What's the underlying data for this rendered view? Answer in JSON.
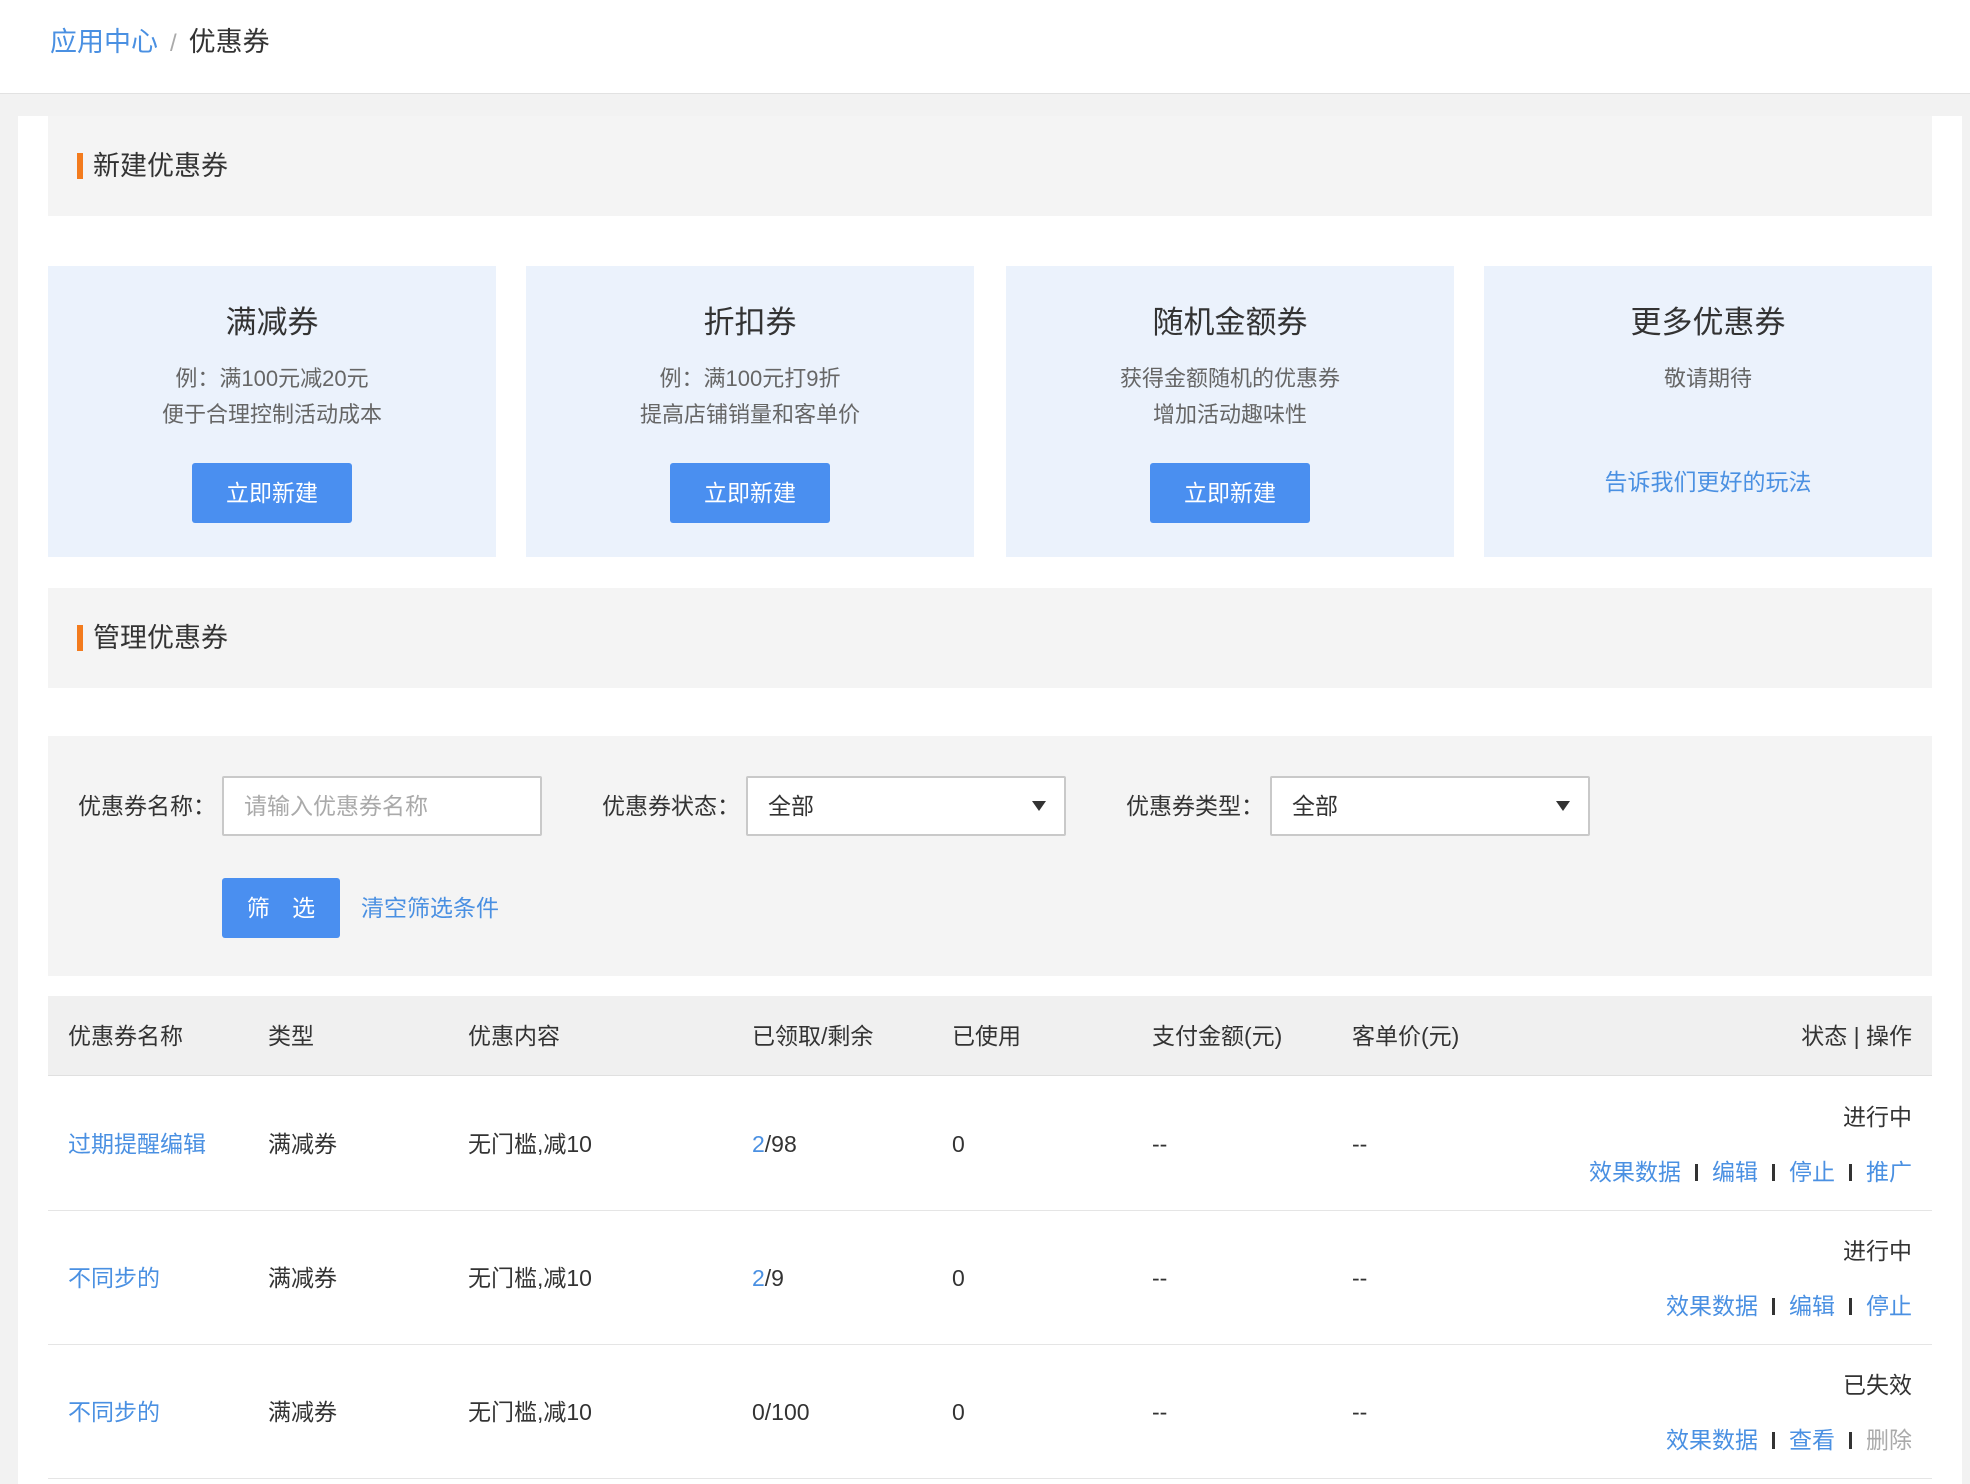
{
  "breadcrumb": {
    "parent": "应用中心",
    "separator": "/",
    "current": "优惠券"
  },
  "create_section": {
    "title": "新建优惠券"
  },
  "cards": [
    {
      "title": "满减券",
      "desc1": "例：满100元减20元",
      "desc2": "便于合理控制活动成本",
      "button": "立即新建"
    },
    {
      "title": "折扣券",
      "desc1": "例：满100元打9折",
      "desc2": "提高店铺销量和客单价",
      "button": "立即新建"
    },
    {
      "title": "随机金额券",
      "desc1": "获得金额随机的优惠券",
      "desc2": "增加活动趣味性",
      "button": "立即新建"
    },
    {
      "title": "更多优惠券",
      "desc1": "敬请期待",
      "link": "告诉我们更好的玩法"
    }
  ],
  "manage_section": {
    "title": "管理优惠券"
  },
  "filter": {
    "name_label": "优惠券名称：",
    "name_placeholder": "请输入优惠券名称",
    "status_label": "优惠券状态：",
    "status_value": "全部",
    "type_label": "优惠券类型：",
    "type_value": "全部",
    "submit": "筛 选",
    "clear": "清空筛选条件"
  },
  "table": {
    "headers": [
      "优惠券名称",
      "类型",
      "优惠内容",
      "已领取/剩余",
      "已使用",
      "支付金额(元)",
      "客单价(元)",
      "状态 | 操作"
    ],
    "rows": [
      {
        "name": "过期提醒编辑",
        "type": "满减券",
        "content": "无门槛,减10",
        "claimed": "2",
        "remaining": "/98",
        "used": "0",
        "paid": "--",
        "avg": "--",
        "status": "进行中",
        "ops": [
          "效果数据",
          "编辑",
          "停止",
          "推广"
        ]
      },
      {
        "name": "不同步的",
        "type": "满减券",
        "content": "无门槛,减10",
        "claimed": "2",
        "remaining": "/9",
        "used": "0",
        "paid": "--",
        "avg": "--",
        "status": "进行中",
        "ops": [
          "效果数据",
          "编辑",
          "停止"
        ]
      },
      {
        "name": "不同步的",
        "type": "满减券",
        "content": "无门槛,减10",
        "claimed_plain": "0/100",
        "used": "0",
        "paid": "--",
        "avg": "--",
        "status": "已失效",
        "ops": [
          "效果数据",
          "查看",
          "删除"
        ]
      }
    ]
  }
}
